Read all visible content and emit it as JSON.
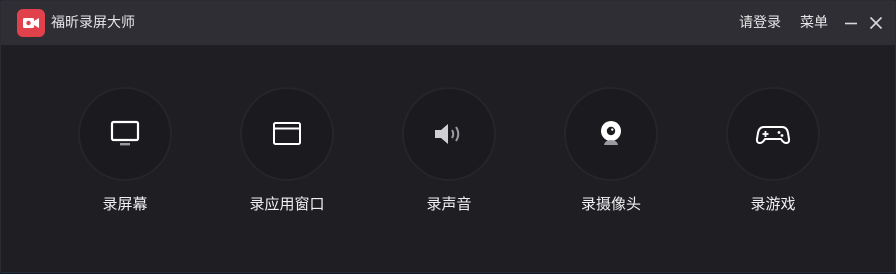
{
  "app": {
    "title": "福昕录屏大师",
    "logo_icon": "video-camera-icon",
    "brand_color": "#e0414b"
  },
  "titlebar": {
    "login_label": "请登录",
    "menu_label": "菜单",
    "minimize_icon": "minimize-icon",
    "close_icon": "close-icon"
  },
  "tools": [
    {
      "label": "录屏幕",
      "icon": "monitor-icon"
    },
    {
      "label": "录应用窗口",
      "icon": "app-window-icon"
    },
    {
      "label": "录声音",
      "icon": "speaker-icon"
    },
    {
      "label": "录摄像头",
      "icon": "webcam-icon"
    },
    {
      "label": "录游戏",
      "icon": "gamepad-icon"
    }
  ]
}
